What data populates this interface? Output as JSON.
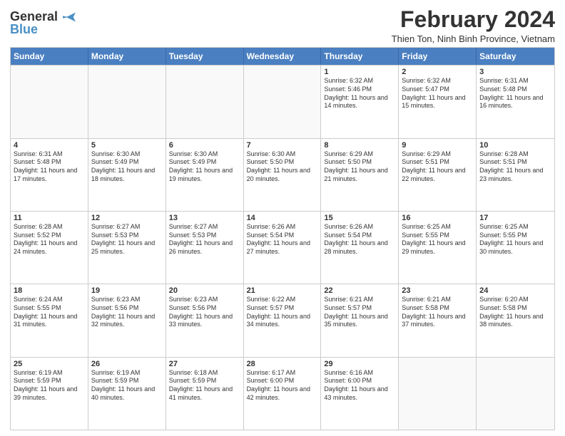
{
  "logo": {
    "line1": "General",
    "line2": "Blue"
  },
  "title": "February 2024",
  "subtitle": "Thien Ton, Ninh Binh Province, Vietnam",
  "headers": [
    "Sunday",
    "Monday",
    "Tuesday",
    "Wednesday",
    "Thursday",
    "Friday",
    "Saturday"
  ],
  "weeks": [
    [
      {
        "day": "",
        "info": ""
      },
      {
        "day": "",
        "info": ""
      },
      {
        "day": "",
        "info": ""
      },
      {
        "day": "",
        "info": ""
      },
      {
        "day": "1",
        "info": "Sunrise: 6:32 AM\nSunset: 5:46 PM\nDaylight: 11 hours and 14 minutes."
      },
      {
        "day": "2",
        "info": "Sunrise: 6:32 AM\nSunset: 5:47 PM\nDaylight: 11 hours and 15 minutes."
      },
      {
        "day": "3",
        "info": "Sunrise: 6:31 AM\nSunset: 5:48 PM\nDaylight: 11 hours and 16 minutes."
      }
    ],
    [
      {
        "day": "4",
        "info": "Sunrise: 6:31 AM\nSunset: 5:48 PM\nDaylight: 11 hours and 17 minutes."
      },
      {
        "day": "5",
        "info": "Sunrise: 6:30 AM\nSunset: 5:49 PM\nDaylight: 11 hours and 18 minutes."
      },
      {
        "day": "6",
        "info": "Sunrise: 6:30 AM\nSunset: 5:49 PM\nDaylight: 11 hours and 19 minutes."
      },
      {
        "day": "7",
        "info": "Sunrise: 6:30 AM\nSunset: 5:50 PM\nDaylight: 11 hours and 20 minutes."
      },
      {
        "day": "8",
        "info": "Sunrise: 6:29 AM\nSunset: 5:50 PM\nDaylight: 11 hours and 21 minutes."
      },
      {
        "day": "9",
        "info": "Sunrise: 6:29 AM\nSunset: 5:51 PM\nDaylight: 11 hours and 22 minutes."
      },
      {
        "day": "10",
        "info": "Sunrise: 6:28 AM\nSunset: 5:51 PM\nDaylight: 11 hours and 23 minutes."
      }
    ],
    [
      {
        "day": "11",
        "info": "Sunrise: 6:28 AM\nSunset: 5:52 PM\nDaylight: 11 hours and 24 minutes."
      },
      {
        "day": "12",
        "info": "Sunrise: 6:27 AM\nSunset: 5:53 PM\nDaylight: 11 hours and 25 minutes."
      },
      {
        "day": "13",
        "info": "Sunrise: 6:27 AM\nSunset: 5:53 PM\nDaylight: 11 hours and 26 minutes."
      },
      {
        "day": "14",
        "info": "Sunrise: 6:26 AM\nSunset: 5:54 PM\nDaylight: 11 hours and 27 minutes."
      },
      {
        "day": "15",
        "info": "Sunrise: 6:26 AM\nSunset: 5:54 PM\nDaylight: 11 hours and 28 minutes."
      },
      {
        "day": "16",
        "info": "Sunrise: 6:25 AM\nSunset: 5:55 PM\nDaylight: 11 hours and 29 minutes."
      },
      {
        "day": "17",
        "info": "Sunrise: 6:25 AM\nSunset: 5:55 PM\nDaylight: 11 hours and 30 minutes."
      }
    ],
    [
      {
        "day": "18",
        "info": "Sunrise: 6:24 AM\nSunset: 5:55 PM\nDaylight: 11 hours and 31 minutes."
      },
      {
        "day": "19",
        "info": "Sunrise: 6:23 AM\nSunset: 5:56 PM\nDaylight: 11 hours and 32 minutes."
      },
      {
        "day": "20",
        "info": "Sunrise: 6:23 AM\nSunset: 5:56 PM\nDaylight: 11 hours and 33 minutes."
      },
      {
        "day": "21",
        "info": "Sunrise: 6:22 AM\nSunset: 5:57 PM\nDaylight: 11 hours and 34 minutes."
      },
      {
        "day": "22",
        "info": "Sunrise: 6:21 AM\nSunset: 5:57 PM\nDaylight: 11 hours and 35 minutes."
      },
      {
        "day": "23",
        "info": "Sunrise: 6:21 AM\nSunset: 5:58 PM\nDaylight: 11 hours and 37 minutes."
      },
      {
        "day": "24",
        "info": "Sunrise: 6:20 AM\nSunset: 5:58 PM\nDaylight: 11 hours and 38 minutes."
      }
    ],
    [
      {
        "day": "25",
        "info": "Sunrise: 6:19 AM\nSunset: 5:59 PM\nDaylight: 11 hours and 39 minutes."
      },
      {
        "day": "26",
        "info": "Sunrise: 6:19 AM\nSunset: 5:59 PM\nDaylight: 11 hours and 40 minutes."
      },
      {
        "day": "27",
        "info": "Sunrise: 6:18 AM\nSunset: 5:59 PM\nDaylight: 11 hours and 41 minutes."
      },
      {
        "day": "28",
        "info": "Sunrise: 6:17 AM\nSunset: 6:00 PM\nDaylight: 11 hours and 42 minutes."
      },
      {
        "day": "29",
        "info": "Sunrise: 6:16 AM\nSunset: 6:00 PM\nDaylight: 11 hours and 43 minutes."
      },
      {
        "day": "",
        "info": ""
      },
      {
        "day": "",
        "info": ""
      }
    ]
  ]
}
